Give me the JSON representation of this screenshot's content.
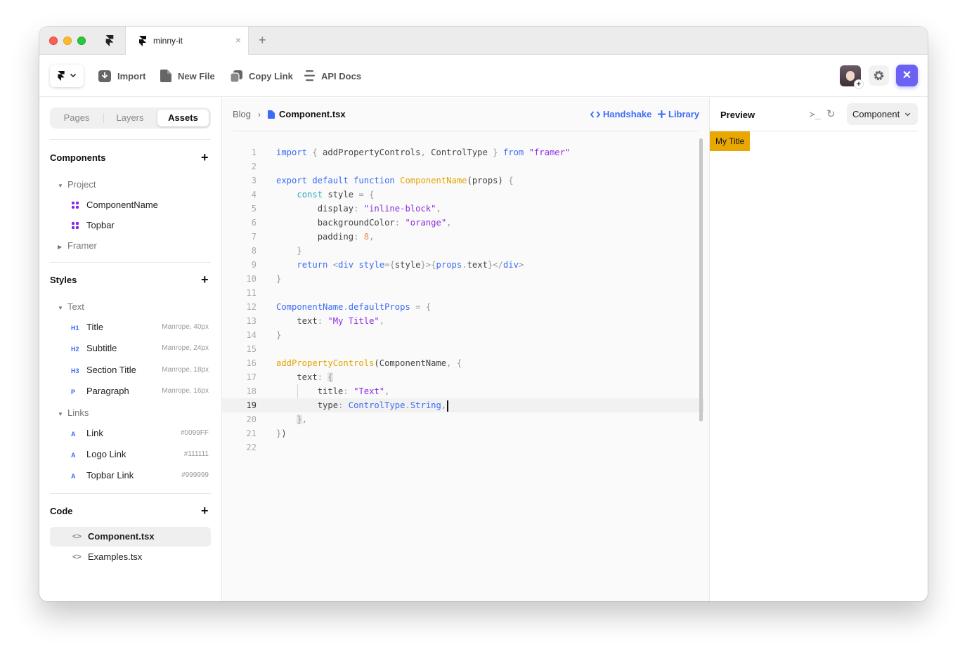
{
  "tabbar": {
    "tab_title": "minny-it",
    "close_glyph": "×",
    "add_glyph": "+"
  },
  "toolbar": {
    "import_label": "Import",
    "new_file_label": "New File",
    "copy_link_label": "Copy Link",
    "api_docs_label": "API Docs",
    "avatar_plus": "+",
    "close_glyph": "✕"
  },
  "sidebar": {
    "tabs": {
      "pages": "Pages",
      "layers": "Layers",
      "assets": "Assets"
    },
    "components": {
      "title": "Components",
      "add": "+",
      "project_group": "Project",
      "items": [
        "ComponentName",
        "Topbar"
      ],
      "framer_group": "Framer"
    },
    "styles": {
      "title": "Styles",
      "add": "+",
      "text_group": "Text",
      "text_items": [
        {
          "tag": "H1",
          "label": "Title",
          "meta": "Manrope, 40px"
        },
        {
          "tag": "H2",
          "label": "Subtitle",
          "meta": "Manrope, 24px"
        },
        {
          "tag": "H3",
          "label": "Section Title",
          "meta": "Manrope, 18px"
        },
        {
          "tag": "P",
          "label": "Paragraph",
          "meta": "Manrope, 16px"
        }
      ],
      "links_group": "Links",
      "link_items": [
        {
          "tag": "A",
          "label": "Link",
          "meta": "#0099FF"
        },
        {
          "tag": "A",
          "label": "Logo Link",
          "meta": "#111111"
        },
        {
          "tag": "A",
          "label": "Topbar Link",
          "meta": "#999999"
        }
      ]
    },
    "code": {
      "title": "Code",
      "add": "+",
      "items": [
        "Component.tsx",
        "Examples.tsx"
      ],
      "icon_glyph": "<>"
    }
  },
  "editor": {
    "breadcrumb_root": "Blog",
    "breadcrumb_sep": "›",
    "breadcrumb_file": "Component.tsx",
    "handshake_label": "Handshake",
    "library_label": "Library",
    "line_numbers": [
      "1",
      "2",
      "3",
      "4",
      "5",
      "6",
      "7",
      "8",
      "9",
      "10",
      "11",
      "12",
      "13",
      "14",
      "15",
      "16",
      "17",
      "18",
      "19",
      "20",
      "21",
      "22"
    ],
    "code_lines": [
      "import { addPropertyControls, ControlType } from \"framer\"",
      "",
      "export default function ComponentName(props) {",
      "    const style = {",
      "        display: \"inline-block\",",
      "        backgroundColor: \"orange\",",
      "        padding: 8,",
      "    }",
      "    return <div style={style}>{props.text}</div>",
      "}",
      "",
      "ComponentName.defaultProps = {",
      "    text: \"My Title\",",
      "}",
      "",
      "addPropertyControls(ComponentName, {",
      "    text: {",
      "        title: \"Text\",",
      "        type: ControlType.String,",
      "    },",
      "})",
      ""
    ],
    "current_line": 19
  },
  "preview": {
    "title": "Preview",
    "terminal_glyph": "≻_",
    "reload_glyph": "↻",
    "select_value": "Component",
    "rendered_text": "My Title"
  },
  "colors": {
    "accent": "#6b62f4",
    "link_blue": "#3b6cf5",
    "component_purple": "#8a2be2",
    "preview_orange": "#e8a800"
  },
  "icons": [
    "framer-logo-icon",
    "chevron-down-icon",
    "import-icon",
    "new-file-icon",
    "copy-link-icon",
    "api-docs-icon",
    "gear-icon",
    "close-icon",
    "component-grid-icon",
    "code-icon",
    "handshake-icon",
    "library-plus-icon",
    "terminal-icon",
    "reload-icon",
    "file-icon"
  ]
}
